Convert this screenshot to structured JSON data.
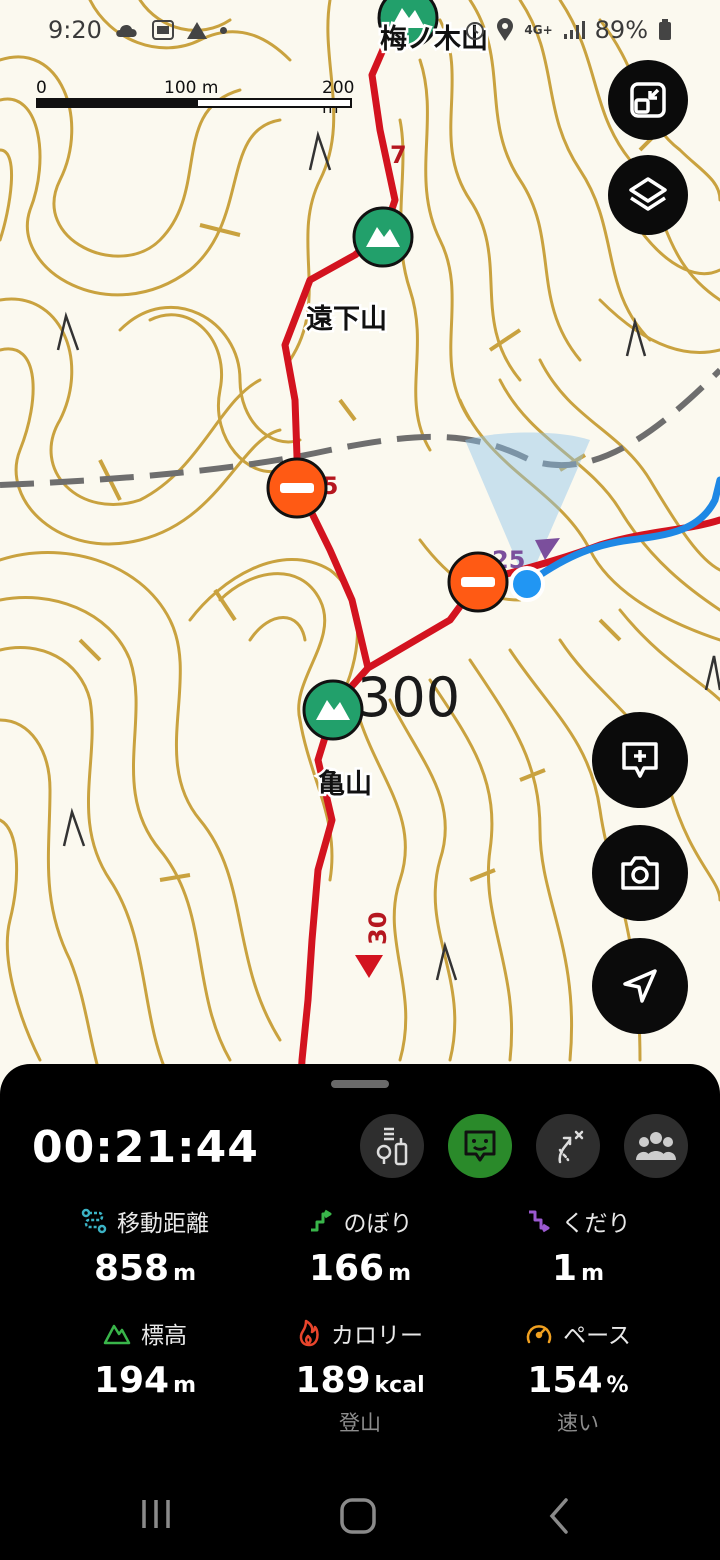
{
  "status_bar": {
    "time": "9:20",
    "battery": "89%",
    "network": "4G+"
  },
  "map": {
    "scale": {
      "label_0": "0",
      "label_mid": "100 m",
      "label_end": "200 m"
    },
    "peaks": [
      {
        "name": "梅ノ木山"
      },
      {
        "name": "遠下山"
      },
      {
        "name": "亀山"
      }
    ],
    "route_markers": {
      "m7": "7",
      "m15": "15",
      "m25": "25",
      "m30": "30"
    },
    "contour_label": "300",
    "colors": {
      "route": "#d3131f",
      "track": "#1e88e5",
      "contour": "#c9a23f",
      "peak": "#22a06b",
      "checkpoint": "#ff5a14"
    }
  },
  "panel": {
    "elapsed": "00:21:44",
    "buttons": [
      "signal-tower-icon",
      "chat-face-icon",
      "off-route-icon",
      "group-icon"
    ],
    "stats": [
      {
        "label": "移動距離",
        "value": "858",
        "unit": "m",
        "icon": "distance-icon"
      },
      {
        "label": "のぼり",
        "value": "166",
        "unit": "m",
        "icon": "ascent-icon"
      },
      {
        "label": "くだり",
        "value": "1",
        "unit": "m",
        "icon": "descent-icon"
      },
      {
        "label": "標高",
        "value": "194",
        "unit": "m",
        "icon": "elevation-icon"
      },
      {
        "label": "カロリー",
        "value": "189",
        "unit": "kcal",
        "sub": "登山",
        "icon": "calorie-icon"
      },
      {
        "label": "ペース",
        "value": "154",
        "unit": "%",
        "sub": "速い",
        "icon": "pace-icon"
      }
    ]
  }
}
